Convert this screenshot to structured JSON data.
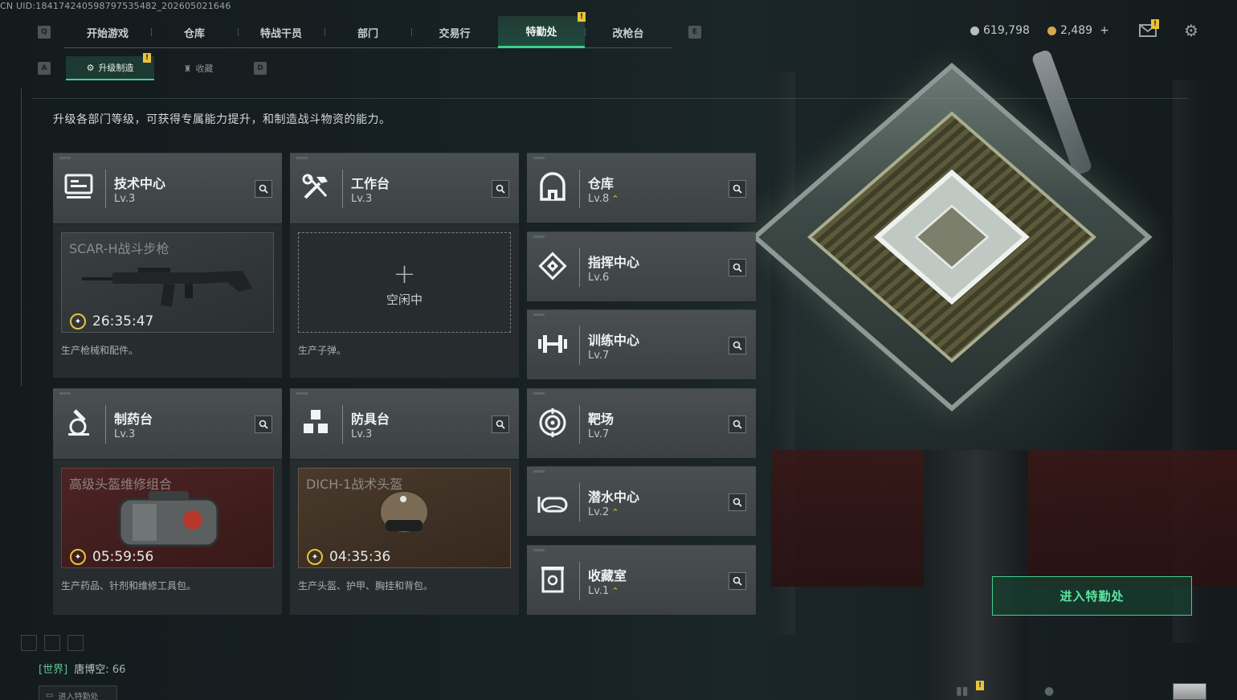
{
  "uid": "CN UID:184174240598797535482_202605021646",
  "nav": {
    "left_key": "Q",
    "right_key": "E",
    "tabs": [
      "开始游戏",
      "仓库",
      "特战干员",
      "部门",
      "交易行",
      "特勤处",
      "改枪台"
    ],
    "active_tab": "特勤处",
    "badge": "!"
  },
  "currency": {
    "silver": "619,798",
    "gold": "2,489",
    "gold_add": "+"
  },
  "icons": {
    "mail": "mail-icon",
    "settings": "gear-icon"
  },
  "subtabs": {
    "left_key": "A",
    "right_key": "D",
    "items": [
      "升级制造",
      "收藏"
    ],
    "badge": "!"
  },
  "headline": "升级各部门等级，可获得专属能力提升，和制造战斗物资的能力。",
  "production_cards": [
    {
      "title": "技术中心",
      "level": "Lv.3",
      "icon": "computer-icon",
      "slot_name": "SCAR-H战斗步枪",
      "timer": "26:35:47",
      "desc": "生产枪械和配件。"
    },
    {
      "title": "工作台",
      "level": "Lv.3",
      "icon": "tools-icon",
      "slot_plus": "+",
      "slot_idle": "空闲中",
      "desc": "生产子弹。"
    },
    {
      "title": "制药台",
      "level": "Lv.3",
      "icon": "microscope-icon",
      "slot_name": "高级头盔维修组合",
      "timer": "05:59:56",
      "desc": "生产药品、针剂和维修工具包。"
    },
    {
      "title": "防具台",
      "level": "Lv.3",
      "icon": "armor-blocks-icon",
      "slot_name": "DICH-1战术头盔",
      "timer": "04:35:36",
      "desc": "生产头盔、护甲、胸挂和背包。"
    }
  ],
  "facility_cards": [
    {
      "title": "仓库",
      "level": "Lv.8",
      "upgrade": "⌃",
      "icon": "warehouse-icon"
    },
    {
      "title": "指挥中心",
      "level": "Lv.6",
      "icon": "command-icon"
    },
    {
      "title": "训练中心",
      "level": "Lv.7",
      "icon": "dumbbell-icon"
    },
    {
      "title": "靶场",
      "level": "Lv.7",
      "icon": "target-icon"
    },
    {
      "title": "潜水中心",
      "level": "Lv.2",
      "upgrade": "⌃",
      "icon": "goggles-icon"
    },
    {
      "title": "收藏室",
      "level": "Lv.1",
      "upgrade": "⌃",
      "icon": "collection-icon"
    }
  ],
  "enter_button": "进入特勤处",
  "chat": {
    "channel": "[世界]",
    "name": "唐博空:",
    "message": "66"
  },
  "bottom_button": "进入特勤处"
}
